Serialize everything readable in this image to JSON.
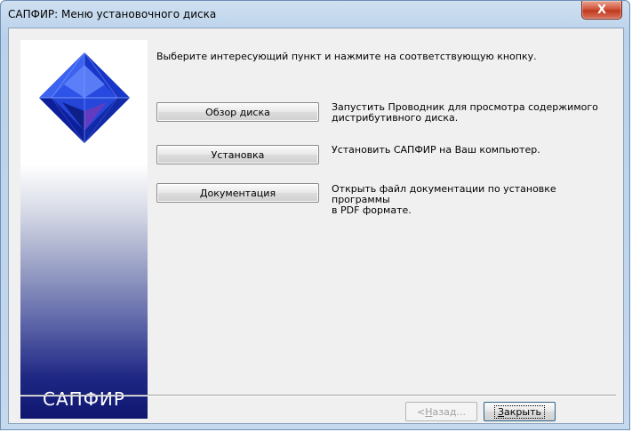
{
  "window": {
    "title": "САПФИР: Меню установочного диска",
    "close_glyph": "X"
  },
  "banner": {
    "title": "САПФИР",
    "logo_icon": "blue-gem-icon"
  },
  "instruction": "Выберите интересующий пункт и нажмите на соответствующую кнопку.",
  "actions": [
    {
      "label": "Обзор диска",
      "description_lines": [
        "Запустить Проводник для просмотра содержимого",
        "дистрибутивного диска."
      ]
    },
    {
      "label": "Установка",
      "description_lines": [
        "Установить САПФИР на Ваш компьютер."
      ]
    },
    {
      "label": "Документация",
      "description_lines": [
        "Открыть файл документации по установке программы",
        "в PDF формате."
      ]
    }
  ],
  "footer": {
    "back_prefix": "< ",
    "back_hotkey": "Н",
    "back_rest": "азад...",
    "close_hotkey": "З",
    "close_rest": "акрыть"
  },
  "colors": {
    "banner_dark": "#0e1670",
    "gem_blue": "#1f3fd0",
    "close_red": "#c0391f"
  }
}
